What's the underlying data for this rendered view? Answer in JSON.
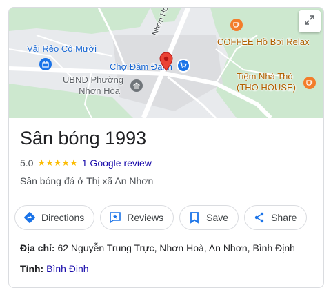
{
  "map": {
    "labels": {
      "vai_reo": "Vải Rẻo Cô Mười",
      "ubnd_line1": "UBND Phường",
      "ubnd_line2": "Nhơn Hòa",
      "cho_dam_danh": "Chợ Đầm Đanh",
      "coffee": "COFFEE Hồ Bơi Relax",
      "tiem_nha_tho_line1": "Tiệm Nhà Thỏ",
      "tiem_nha_tho_line2": "(THO HOUSE)",
      "road": "Nhơn Hòa - Bìn"
    },
    "colors": {
      "poi_blue": "#1a73e8",
      "poi_orange": "#f37d2b",
      "poi_gray": "#70757a",
      "pin_red": "#ea4335",
      "greenery": "#cde8cf"
    }
  },
  "place": {
    "title": "Sân bóng 1993",
    "rating": "5.0",
    "stars": "★★★★★",
    "review_link": "1 Google review",
    "category": "Sân bóng đá ở Thị xã An Nhơn"
  },
  "actions": {
    "directions": "Directions",
    "reviews": "Reviews",
    "save": "Save",
    "share": "Share"
  },
  "info": {
    "address_label": "Địa chỉ:",
    "address_value": "62 Nguyễn Trung Trực, Nhơn Hoà, An Nhơn, Bình Định",
    "province_label": "Tỉnh:",
    "province_value": "Bình Định"
  }
}
